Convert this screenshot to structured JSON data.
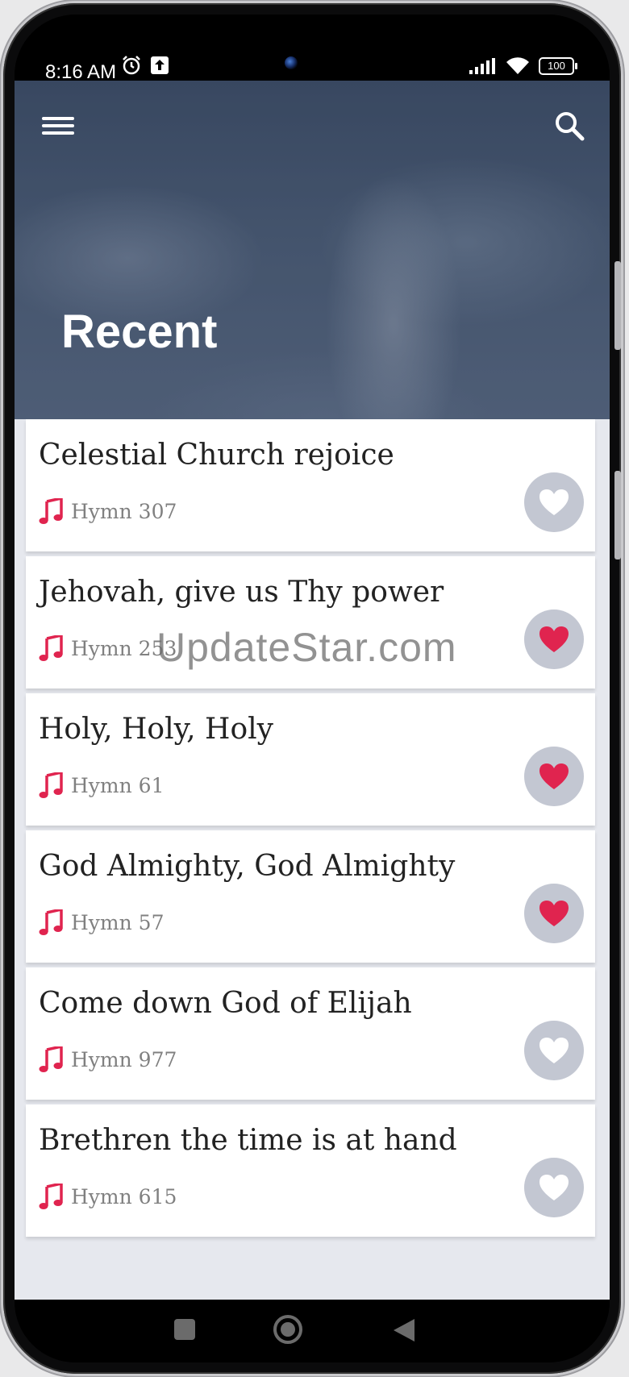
{
  "status_bar": {
    "time": "8:16 AM",
    "left_icons": [
      "alarm-icon",
      "upload-icon"
    ],
    "right_icons": [
      "signal-icon",
      "wifi-icon"
    ],
    "battery": "100"
  },
  "header": {
    "title": "Recent",
    "menu_icon": "menu-icon",
    "search_icon": "search-icon"
  },
  "hymns": [
    {
      "title": "Celestial Church rejoice",
      "number": "Hymn 307",
      "favorite": false
    },
    {
      "title": "Jehovah, give us Thy power",
      "number": "Hymn 253",
      "favorite": true
    },
    {
      "title": "Holy, Holy, Holy",
      "number": "Hymn 61",
      "favorite": true
    },
    {
      "title": "God Almighty, God Almighty",
      "number": "Hymn 57",
      "favorite": true
    },
    {
      "title": "Come down God of Elijah",
      "number": "Hymn 977",
      "favorite": false
    },
    {
      "title": "Brethren the time is at hand",
      "number": "Hymn 615",
      "favorite": false
    }
  ],
  "watermark": "UpdateStar.com",
  "colors": {
    "accent": "#e0244f",
    "fav_bg": "#c3c7d2",
    "header_bg": "#4d5d76"
  },
  "nav_bar": [
    "recents-square-icon",
    "home-circle-icon",
    "back-triangle-icon"
  ]
}
